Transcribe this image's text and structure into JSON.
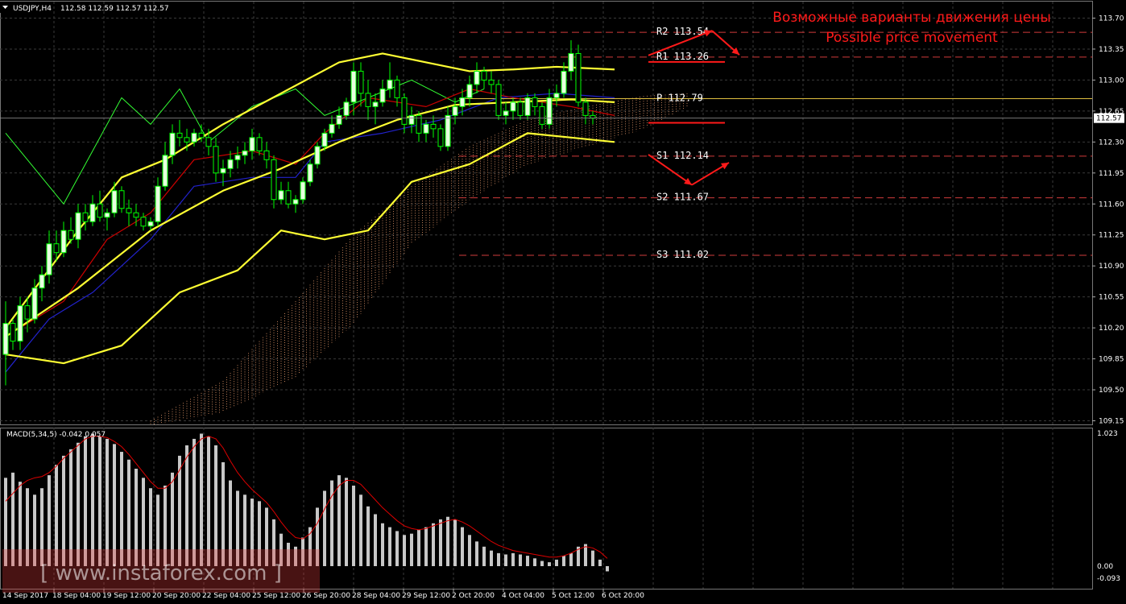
{
  "header": {
    "symbol": "USDJPY,H4",
    "quote": "112.58 112.59 112.57 112.57"
  },
  "macd_header": "MACD(5,34,5) -0.042 0.057",
  "watermark": "[ www.instaforex.com ]",
  "annotation": {
    "line1": "Возможные варианты движения цены",
    "line2": "Possible price movement"
  },
  "colors": {
    "background": "#000000",
    "grid": "#3a3a3a",
    "candle_up": "#e8ffe0",
    "candle_down": "#000000",
    "candle_wick": "#00ff00",
    "bollinger": "#ffff33",
    "tenkan": "#cc0000",
    "kijun": "#2222cc",
    "chikou": "#33ff33",
    "cloud": "#f0a070",
    "pivot_line": "#d13b3b",
    "pivot_p": "#e0c040",
    "macd_bar": "#c8c8c8",
    "macd_signal": "#dd0000",
    "annotation": "#ff1a1a"
  },
  "chart_data": {
    "type": "candlestick",
    "instrument": "USDJPY",
    "timeframe": "H4",
    "price_axis": {
      "min": 109.1,
      "max": 113.85,
      "ticks": [
        113.7,
        113.35,
        113.0,
        112.65,
        112.3,
        111.95,
        111.6,
        111.25,
        110.9,
        110.55,
        110.2,
        109.85,
        109.5,
        109.15
      ],
      "tick_labels": [
        "113.70",
        "113.35",
        "113.00",
        "112.65",
        "112.30",
        "111.95",
        "111.60",
        "111.25",
        "110.90",
        "110.55",
        "110.20",
        "109.85",
        "109.50",
        "109.15"
      ]
    },
    "current_price": {
      "value": 112.57,
      "label": "112.57"
    },
    "time_axis": [
      "14 Sep 2017",
      "18 Sep 04:00",
      "19 Sep 12:00",
      "20 Sep 20:00",
      "22 Sep 04:00",
      "25 Sep 12:00",
      "26 Sep 20:00",
      "28 Sep 04:00",
      "29 Sep 12:00",
      "2 Oct 20:00",
      "4 Oct 04:00",
      "5 Oct 12:00",
      "6 Oct 20:00"
    ],
    "candles": [
      [
        109.9,
        110.5,
        109.55,
        110.25
      ],
      [
        110.25,
        110.3,
        109.95,
        110.05
      ],
      [
        110.05,
        110.55,
        109.95,
        110.45
      ],
      [
        110.45,
        110.55,
        110.15,
        110.3
      ],
      [
        110.3,
        110.75,
        110.25,
        110.65
      ],
      [
        110.65,
        110.9,
        110.5,
        110.8
      ],
      [
        110.8,
        111.3,
        110.7,
        111.15
      ],
      [
        111.15,
        111.3,
        110.95,
        111.05
      ],
      [
        111.05,
        111.4,
        111.0,
        111.3
      ],
      [
        111.3,
        111.45,
        111.15,
        111.2
      ],
      [
        111.2,
        111.6,
        111.1,
        111.5
      ],
      [
        111.5,
        111.6,
        111.3,
        111.4
      ],
      [
        111.4,
        111.7,
        111.35,
        111.6
      ],
      [
        111.6,
        111.75,
        111.4,
        111.45
      ],
      [
        111.45,
        111.55,
        111.3,
        111.5
      ],
      [
        111.5,
        111.85,
        111.45,
        111.75
      ],
      [
        111.75,
        111.8,
        111.5,
        111.55
      ],
      [
        111.55,
        111.65,
        111.35,
        111.5
      ],
      [
        111.5,
        111.6,
        111.35,
        111.45
      ],
      [
        111.45,
        111.5,
        111.3,
        111.35
      ],
      [
        111.35,
        111.45,
        111.3,
        111.4
      ],
      [
        111.4,
        111.9,
        111.35,
        111.8
      ],
      [
        111.8,
        112.3,
        111.75,
        112.15
      ],
      [
        112.15,
        112.5,
        112.05,
        112.4
      ],
      [
        112.4,
        112.55,
        112.25,
        112.35
      ],
      [
        112.35,
        112.45,
        112.2,
        112.3
      ],
      [
        112.3,
        112.45,
        112.25,
        112.4
      ],
      [
        112.4,
        112.5,
        112.3,
        112.35
      ],
      [
        112.35,
        112.45,
        112.15,
        112.25
      ],
      [
        112.25,
        112.35,
        111.85,
        111.95
      ],
      [
        111.95,
        112.1,
        111.8,
        112.0
      ],
      [
        112.0,
        112.2,
        111.9,
        112.1
      ],
      [
        112.1,
        112.25,
        112.0,
        112.15
      ],
      [
        112.15,
        112.3,
        112.05,
        112.2
      ],
      [
        112.2,
        112.45,
        112.1,
        112.35
      ],
      [
        112.35,
        112.4,
        112.15,
        112.2
      ],
      [
        112.2,
        112.3,
        112.0,
        112.1
      ],
      [
        112.1,
        112.15,
        111.55,
        111.65
      ],
      [
        111.65,
        111.85,
        111.6,
        111.75
      ],
      [
        111.75,
        111.85,
        111.55,
        111.6
      ],
      [
        111.6,
        111.7,
        111.5,
        111.65
      ],
      [
        111.65,
        111.9,
        111.6,
        111.85
      ],
      [
        111.85,
        112.1,
        111.8,
        112.05
      ],
      [
        112.05,
        112.3,
        112.0,
        112.25
      ],
      [
        112.25,
        112.45,
        112.2,
        112.4
      ],
      [
        112.4,
        112.6,
        112.35,
        112.5
      ],
      [
        112.5,
        112.7,
        112.45,
        112.6
      ],
      [
        112.6,
        112.8,
        112.55,
        112.75
      ],
      [
        112.75,
        113.2,
        112.6,
        113.1
      ],
      [
        113.1,
        113.2,
        112.7,
        112.85
      ],
      [
        112.85,
        113.0,
        112.55,
        112.7
      ],
      [
        112.7,
        112.85,
        112.5,
        112.75
      ],
      [
        112.75,
        113.0,
        112.7,
        112.9
      ],
      [
        112.9,
        113.2,
        112.8,
        113.0
      ],
      [
        113.0,
        113.05,
        112.7,
        112.8
      ],
      [
        112.8,
        112.85,
        112.4,
        112.5
      ],
      [
        112.5,
        112.7,
        112.4,
        112.6
      ],
      [
        112.6,
        112.65,
        112.3,
        112.4
      ],
      [
        112.4,
        112.55,
        112.3,
        112.5
      ],
      [
        112.5,
        112.6,
        112.35,
        112.45
      ],
      [
        112.45,
        112.5,
        112.2,
        112.25
      ],
      [
        112.25,
        112.7,
        112.2,
        112.6
      ],
      [
        112.6,
        112.8,
        112.5,
        112.7
      ],
      [
        112.7,
        112.9,
        112.6,
        112.8
      ],
      [
        112.8,
        113.05,
        112.7,
        112.95
      ],
      [
        112.95,
        113.2,
        112.85,
        113.1
      ],
      [
        113.1,
        113.15,
        112.9,
        113.0
      ],
      [
        113.0,
        113.1,
        112.85,
        112.95
      ],
      [
        112.95,
        113.0,
        112.55,
        112.6
      ],
      [
        112.6,
        112.75,
        112.5,
        112.65
      ],
      [
        112.65,
        112.8,
        112.55,
        112.75
      ],
      [
        112.75,
        112.8,
        112.55,
        112.6
      ],
      [
        112.6,
        112.85,
        112.55,
        112.8
      ],
      [
        112.8,
        112.85,
        112.6,
        112.7
      ],
      [
        112.7,
        112.75,
        112.45,
        112.5
      ],
      [
        112.5,
        112.9,
        112.45,
        112.8
      ],
      [
        112.8,
        112.95,
        112.7,
        112.85
      ],
      [
        112.85,
        113.2,
        112.8,
        113.1
      ],
      [
        113.1,
        113.45,
        113.0,
        113.3
      ],
      [
        113.3,
        113.4,
        112.7,
        112.75
      ],
      [
        112.75,
        112.8,
        112.5,
        112.6
      ],
      [
        112.6,
        112.65,
        112.5,
        112.57
      ]
    ],
    "indicators": {
      "bollinger_upper": [
        [
          0,
          110.2
        ],
        [
          10,
          111.3
        ],
        [
          16,
          111.9
        ],
        [
          22,
          112.1
        ],
        [
          30,
          112.5
        ],
        [
          38,
          112.85
        ],
        [
          46,
          113.2
        ],
        [
          52,
          113.3
        ],
        [
          58,
          113.2
        ],
        [
          64,
          113.1
        ],
        [
          70,
          113.12
        ],
        [
          76,
          113.15
        ],
        [
          84,
          113.12
        ]
      ],
      "bollinger_middle": [
        [
          0,
          110.1
        ],
        [
          10,
          110.65
        ],
        [
          20,
          111.3
        ],
        [
          30,
          111.75
        ],
        [
          38,
          112.0
        ],
        [
          46,
          112.3
        ],
        [
          54,
          112.55
        ],
        [
          62,
          112.72
        ],
        [
          70,
          112.75
        ],
        [
          78,
          112.78
        ],
        [
          84,
          112.75
        ]
      ],
      "bollinger_lower": [
        [
          0,
          109.9
        ],
        [
          8,
          109.8
        ],
        [
          16,
          110.0
        ],
        [
          24,
          110.6
        ],
        [
          32,
          110.85
        ],
        [
          38,
          111.3
        ],
        [
          44,
          111.2
        ],
        [
          50,
          111.3
        ],
        [
          56,
          111.85
        ],
        [
          64,
          112.05
        ],
        [
          72,
          112.4
        ],
        [
          78,
          112.35
        ],
        [
          84,
          112.3
        ]
      ],
      "tenkan": [
        [
          0,
          110.1
        ],
        [
          8,
          110.5
        ],
        [
          14,
          111.2
        ],
        [
          20,
          111.5
        ],
        [
          26,
          112.1
        ],
        [
          34,
          112.2
        ],
        [
          40,
          112.05
        ],
        [
          44,
          112.4
        ],
        [
          50,
          112.8
        ],
        [
          58,
          112.7
        ],
        [
          64,
          112.9
        ],
        [
          70,
          112.8
        ],
        [
          78,
          112.7
        ],
        [
          84,
          112.6
        ]
      ],
      "kijun": [
        [
          0,
          109.7
        ],
        [
          6,
          110.3
        ],
        [
          12,
          110.6
        ],
        [
          20,
          111.2
        ],
        [
          26,
          111.8
        ],
        [
          34,
          111.9
        ],
        [
          40,
          111.9
        ],
        [
          44,
          112.3
        ],
        [
          52,
          112.4
        ],
        [
          60,
          112.55
        ],
        [
          68,
          112.8
        ],
        [
          76,
          112.85
        ],
        [
          84,
          112.8
        ]
      ],
      "chikou": [
        [
          0,
          112.4
        ],
        [
          4,
          112.0
        ],
        [
          8,
          111.6
        ],
        [
          12,
          112.2
        ],
        [
          16,
          112.8
        ],
        [
          20,
          112.5
        ],
        [
          24,
          112.9
        ],
        [
          28,
          112.3
        ],
        [
          34,
          112.7
        ],
        [
          40,
          112.9
        ],
        [
          44,
          112.6
        ],
        [
          50,
          112.8
        ],
        [
          56,
          113.0
        ],
        [
          62,
          112.75
        ],
        [
          66,
          112.9
        ]
      ],
      "cloud": {
        "top": [
          [
            20,
            109.15
          ],
          [
            30,
            109.6
          ],
          [
            40,
            110.5
          ],
          [
            48,
            111.25
          ],
          [
            56,
            111.8
          ],
          [
            64,
            112.25
          ],
          [
            72,
            112.55
          ],
          [
            80,
            112.7
          ],
          [
            88,
            112.82
          ],
          [
            94,
            112.85
          ]
        ],
        "bottom": [
          [
            20,
            109.15
          ],
          [
            30,
            109.3
          ],
          [
            40,
            109.7
          ],
          [
            48,
            110.3
          ],
          [
            56,
            111.2
          ],
          [
            64,
            111.7
          ],
          [
            72,
            112.1
          ],
          [
            80,
            112.3
          ],
          [
            88,
            112.5
          ],
          [
            94,
            112.75
          ]
        ]
      }
    },
    "pivot_levels": [
      {
        "name": "R2",
        "value": 113.54,
        "label": "R2 113.54"
      },
      {
        "name": "R1",
        "value": 113.26,
        "label": "R1 113.26"
      },
      {
        "name": "P",
        "value": 112.79,
        "label": "P 112.79"
      },
      {
        "name": "S1",
        "value": 112.14,
        "label": "S1 112.14"
      },
      {
        "name": "S2",
        "value": 111.67,
        "label": "S2 111.67"
      },
      {
        "name": "S3",
        "value": 111.02,
        "label": "S3 111.02"
      }
    ],
    "macd": {
      "params": "5,34,5",
      "main": -0.042,
      "signal": 0.057,
      "axis_labels": [
        "1.023",
        "0.00",
        "-0.093"
      ],
      "axis_min": -0.093,
      "axis_max": 1.023,
      "histogram": [
        0.68,
        0.72,
        0.65,
        0.6,
        0.55,
        0.6,
        0.7,
        0.78,
        0.85,
        0.9,
        0.95,
        1.0,
        1.02,
        1.0,
        0.98,
        0.94,
        0.88,
        0.82,
        0.75,
        0.68,
        0.6,
        0.55,
        0.62,
        0.72,
        0.85,
        0.93,
        0.98,
        1.02,
        1.0,
        0.93,
        0.8,
        0.66,
        0.58,
        0.55,
        0.52,
        0.5,
        0.45,
        0.36,
        0.25,
        0.18,
        0.15,
        0.22,
        0.3,
        0.45,
        0.58,
        0.66,
        0.7,
        0.68,
        0.62,
        0.55,
        0.46,
        0.4,
        0.33,
        0.3,
        0.27,
        0.24,
        0.25,
        0.28,
        0.3,
        0.33,
        0.36,
        0.38,
        0.36,
        0.3,
        0.24,
        0.19,
        0.15,
        0.12,
        0.1,
        0.09,
        0.1,
        0.09,
        0.08,
        0.06,
        0.04,
        0.03,
        0.05,
        0.08,
        0.1,
        0.15,
        0.17,
        0.12,
        0.05,
        -0.04
      ],
      "signal_line": [
        0.5,
        0.56,
        0.62,
        0.66,
        0.68,
        0.69,
        0.72,
        0.77,
        0.83,
        0.88,
        0.93,
        0.98,
        1.0,
        1.0,
        0.99,
        0.96,
        0.92,
        0.86,
        0.79,
        0.72,
        0.65,
        0.6,
        0.6,
        0.65,
        0.74,
        0.84,
        0.92,
        0.98,
        1.0,
        0.98,
        0.91,
        0.81,
        0.72,
        0.65,
        0.59,
        0.54,
        0.49,
        0.42,
        0.34,
        0.27,
        0.22,
        0.21,
        0.25,
        0.33,
        0.44,
        0.54,
        0.62,
        0.66,
        0.66,
        0.63,
        0.57,
        0.51,
        0.45,
        0.4,
        0.35,
        0.31,
        0.29,
        0.28,
        0.29,
        0.31,
        0.33,
        0.35,
        0.36,
        0.34,
        0.31,
        0.27,
        0.23,
        0.19,
        0.16,
        0.14,
        0.12,
        0.11,
        0.1,
        0.09,
        0.08,
        0.07,
        0.07,
        0.08,
        0.1,
        0.13,
        0.15,
        0.14,
        0.11,
        0.06
      ]
    }
  }
}
